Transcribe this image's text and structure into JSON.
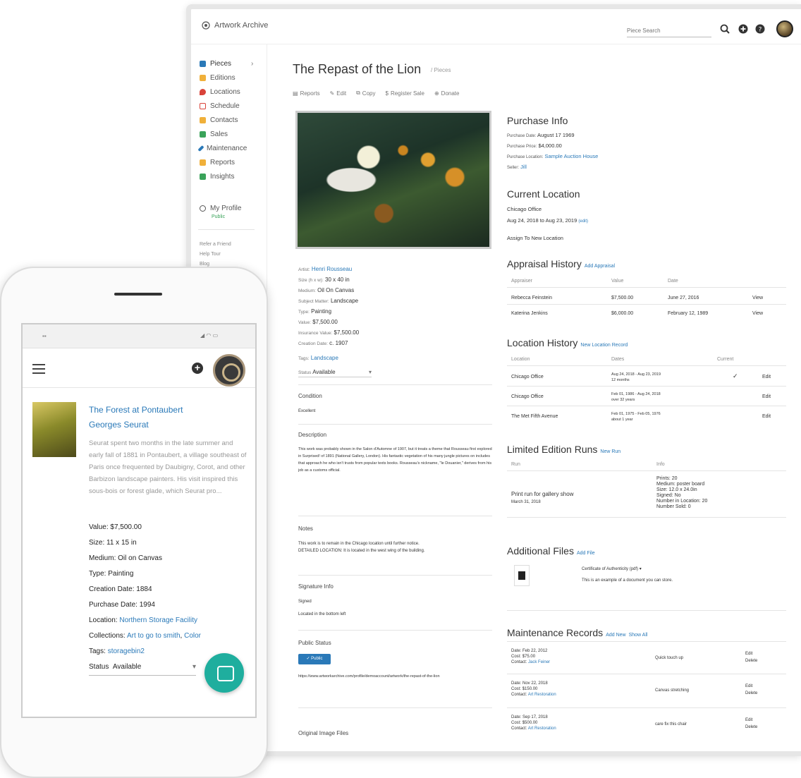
{
  "desktop": {
    "app_name": "Artwork Archive",
    "search_placeholder": "Piece Search",
    "sidebar": {
      "items": [
        {
          "label": "Pieces",
          "color": "#2a79b8"
        },
        {
          "label": "Editions",
          "color": "#f0b03a"
        },
        {
          "label": "Locations",
          "color": "#d9433a"
        },
        {
          "label": "Schedule",
          "color": "#d9433a"
        },
        {
          "label": "Contacts",
          "color": "#f0b03a"
        },
        {
          "label": "Sales",
          "color": "#3aa35a"
        },
        {
          "label": "Maintenance",
          "color": "#2a79b8"
        },
        {
          "label": "Reports",
          "color": "#f0b03a"
        },
        {
          "label": "Insights",
          "color": "#3aa35a"
        }
      ],
      "profile_label": "My Profile",
      "profile_sub": "Public",
      "footer_links": [
        "Refer a Friend",
        "Help Tour",
        "Blog"
      ]
    },
    "title": "The Repast of the Lion",
    "crumb": "Pieces",
    "actions": [
      "Reports",
      "Edit",
      "Copy",
      "Register Sale",
      "Donate"
    ],
    "details": {
      "artist_label": "Artist:",
      "artist": "Henri Rousseau",
      "size_label": "Size (h x w):",
      "size": "30 x 40 in",
      "medium_label": "Medium:",
      "medium": "Oil On Canvas",
      "subject_label": "Subject Matter:",
      "subject": "Landscape",
      "type_label": "Type:",
      "type": "Painting",
      "value_label": "Value:",
      "value": "$7,500.00",
      "insurance_label": "Insurance Value:",
      "insurance": "$7,500.00",
      "creation_label": "Creation Date:",
      "creation": "c. 1907",
      "tags_label": "Tags:",
      "tags": "Landscape",
      "status_label": "Status",
      "status": "Available"
    },
    "condition": {
      "heading": "Condition",
      "text": "Excellent"
    },
    "description": {
      "heading": "Description",
      "text": "This work was probably shown in the Salon d'Automne of 1907, but it treats a theme that Rousseau first explored in Surprised! of 1891 (National Gallery, London). His fantastic vegetation of his many jungle pictures on includes that approach he who isn't trusts from popular texts books. Rousseau's nickname, \"le Douanier,\" derives from his job as a customs official."
    },
    "notes": {
      "heading": "Notes",
      "line1": "This work is to remain in the Chicago location until further notice.",
      "line2": "DETAILED LOCATION: It is located in the west wing of the building."
    },
    "signature": {
      "heading": "Signature Info",
      "signed": "Signed",
      "located": "Located in the bottom left"
    },
    "public_status": {
      "heading": "Public Status",
      "button": "Public",
      "url": "https://www.artworkarchive.com/profile/demoaccount/artwork/the-repast-of-the-lion"
    },
    "original_files": "Original Image Files",
    "purchase": {
      "heading": "Purchase Info",
      "date_label": "Purchase Date:",
      "date": "August 17 1969",
      "price_label": "Purchase Price:",
      "price": "$4,000.00",
      "location_label": "Purchase Location:",
      "location": "Sample Auction House",
      "seller_label": "Seller:",
      "seller": "Jill"
    },
    "current_location": {
      "heading": "Current Location",
      "name": "Chicago Office",
      "dates": "Aug 24, 2018 to Aug 23, 2019",
      "edit": "(edit)",
      "assign": "Assign To New Location"
    },
    "appraisal": {
      "heading": "Appraisal History",
      "add": "Add Appraisal",
      "columns": [
        "Appraiser",
        "Value",
        "Date"
      ],
      "rows": [
        {
          "appraiser": "Rebecca Feinstein",
          "value": "$7,500.00",
          "date": "June 27, 2016",
          "action": "View"
        },
        {
          "appraiser": "Katerina Jenkins",
          "value": "$6,000.00",
          "date": "February 12, 1989",
          "action": "View"
        }
      ]
    },
    "location_history": {
      "heading": "Location History",
      "add": "New Location Record",
      "columns": [
        "Location",
        "Dates",
        "Current"
      ],
      "rows": [
        {
          "location": "Chicago Office",
          "dates": "Aug 24, 2018 - Aug 23, 2019",
          "duration": "12 months",
          "current": "✓",
          "action": "Edit"
        },
        {
          "location": "Chicago Office",
          "dates": "Feb 01, 1986 - Aug 24, 2018",
          "duration": "over 32 years",
          "current": "",
          "action": "Edit"
        },
        {
          "location": "The Met Fifth Avenue",
          "dates": "Feb 01, 1975 - Feb 05, 1976",
          "duration": "about 1 year",
          "current": "",
          "action": "Edit"
        }
      ]
    },
    "editions": {
      "heading": "Limited Edition Runs",
      "add": "New Run",
      "columns": [
        "Run",
        "Info"
      ],
      "run_name": "Print run for gallery show",
      "run_date": "March 31, 2018",
      "info": [
        "Prints: 20",
        "Medium: poster board",
        "Size: 12.0 x 24.0in",
        "Signed: No",
        "Number in Location: 20",
        "Number Sold: 0"
      ]
    },
    "files": {
      "heading": "Additional Files",
      "add": "Add File",
      "file_name": "Certificate of Authenticity (pdf)",
      "file_desc": "This is an example of a document you can store."
    },
    "maintenance": {
      "heading": "Maintenance Records",
      "add": "Add New",
      "show_all": "Show All",
      "rows": [
        {
          "date": "Feb 22, 2012",
          "cost": "$75.00",
          "contact": "Jack Feiner",
          "desc": "Quick touch up"
        },
        {
          "date": "Nov 22, 2018",
          "cost": "$150.00",
          "contact": "Art Restoration",
          "desc": "Canvas stretching"
        },
        {
          "date": "Sep 17, 2018",
          "cost": "$500.00",
          "contact": "Art Restoration",
          "desc": "care fix this chair"
        }
      ],
      "labels": {
        "date": "Date:",
        "cost": "Cost:",
        "contact": "Contact:"
      },
      "edit": "Edit",
      "delete": "Delete"
    }
  },
  "phone": {
    "title": "The Forest at Pontaubert",
    "artist": "Georges Seurat",
    "description": "Seurat spent two months in the late summer and early fall of 1881 in Pontaubert, a village southeast of Paris once frequented by Daubigny, Corot, and other Barbizon landscape painters. His visit inspired this sous-bois or forest glade, which Seurat pro...",
    "fields": [
      {
        "label": "Value:",
        "value": "$7,500.00"
      },
      {
        "label": "Size:",
        "value": "11 x 15 in"
      },
      {
        "label": "Medium:",
        "value": "Oil on Canvas"
      },
      {
        "label": "Type:",
        "value": "Painting"
      },
      {
        "label": "Creation Date:",
        "value": "1884"
      },
      {
        "label": "Purchase Date:",
        "value": "1994"
      }
    ],
    "location_label": "Location:",
    "location": "Northern Storage Facility",
    "collections_label": "Collections:",
    "collection_1": "Art to go to smith",
    "collection_sep": ",",
    "collection_2": "Color",
    "tags_label": "Tags:",
    "tags": "storagebin2",
    "status_label": "Status",
    "status": "Available"
  }
}
